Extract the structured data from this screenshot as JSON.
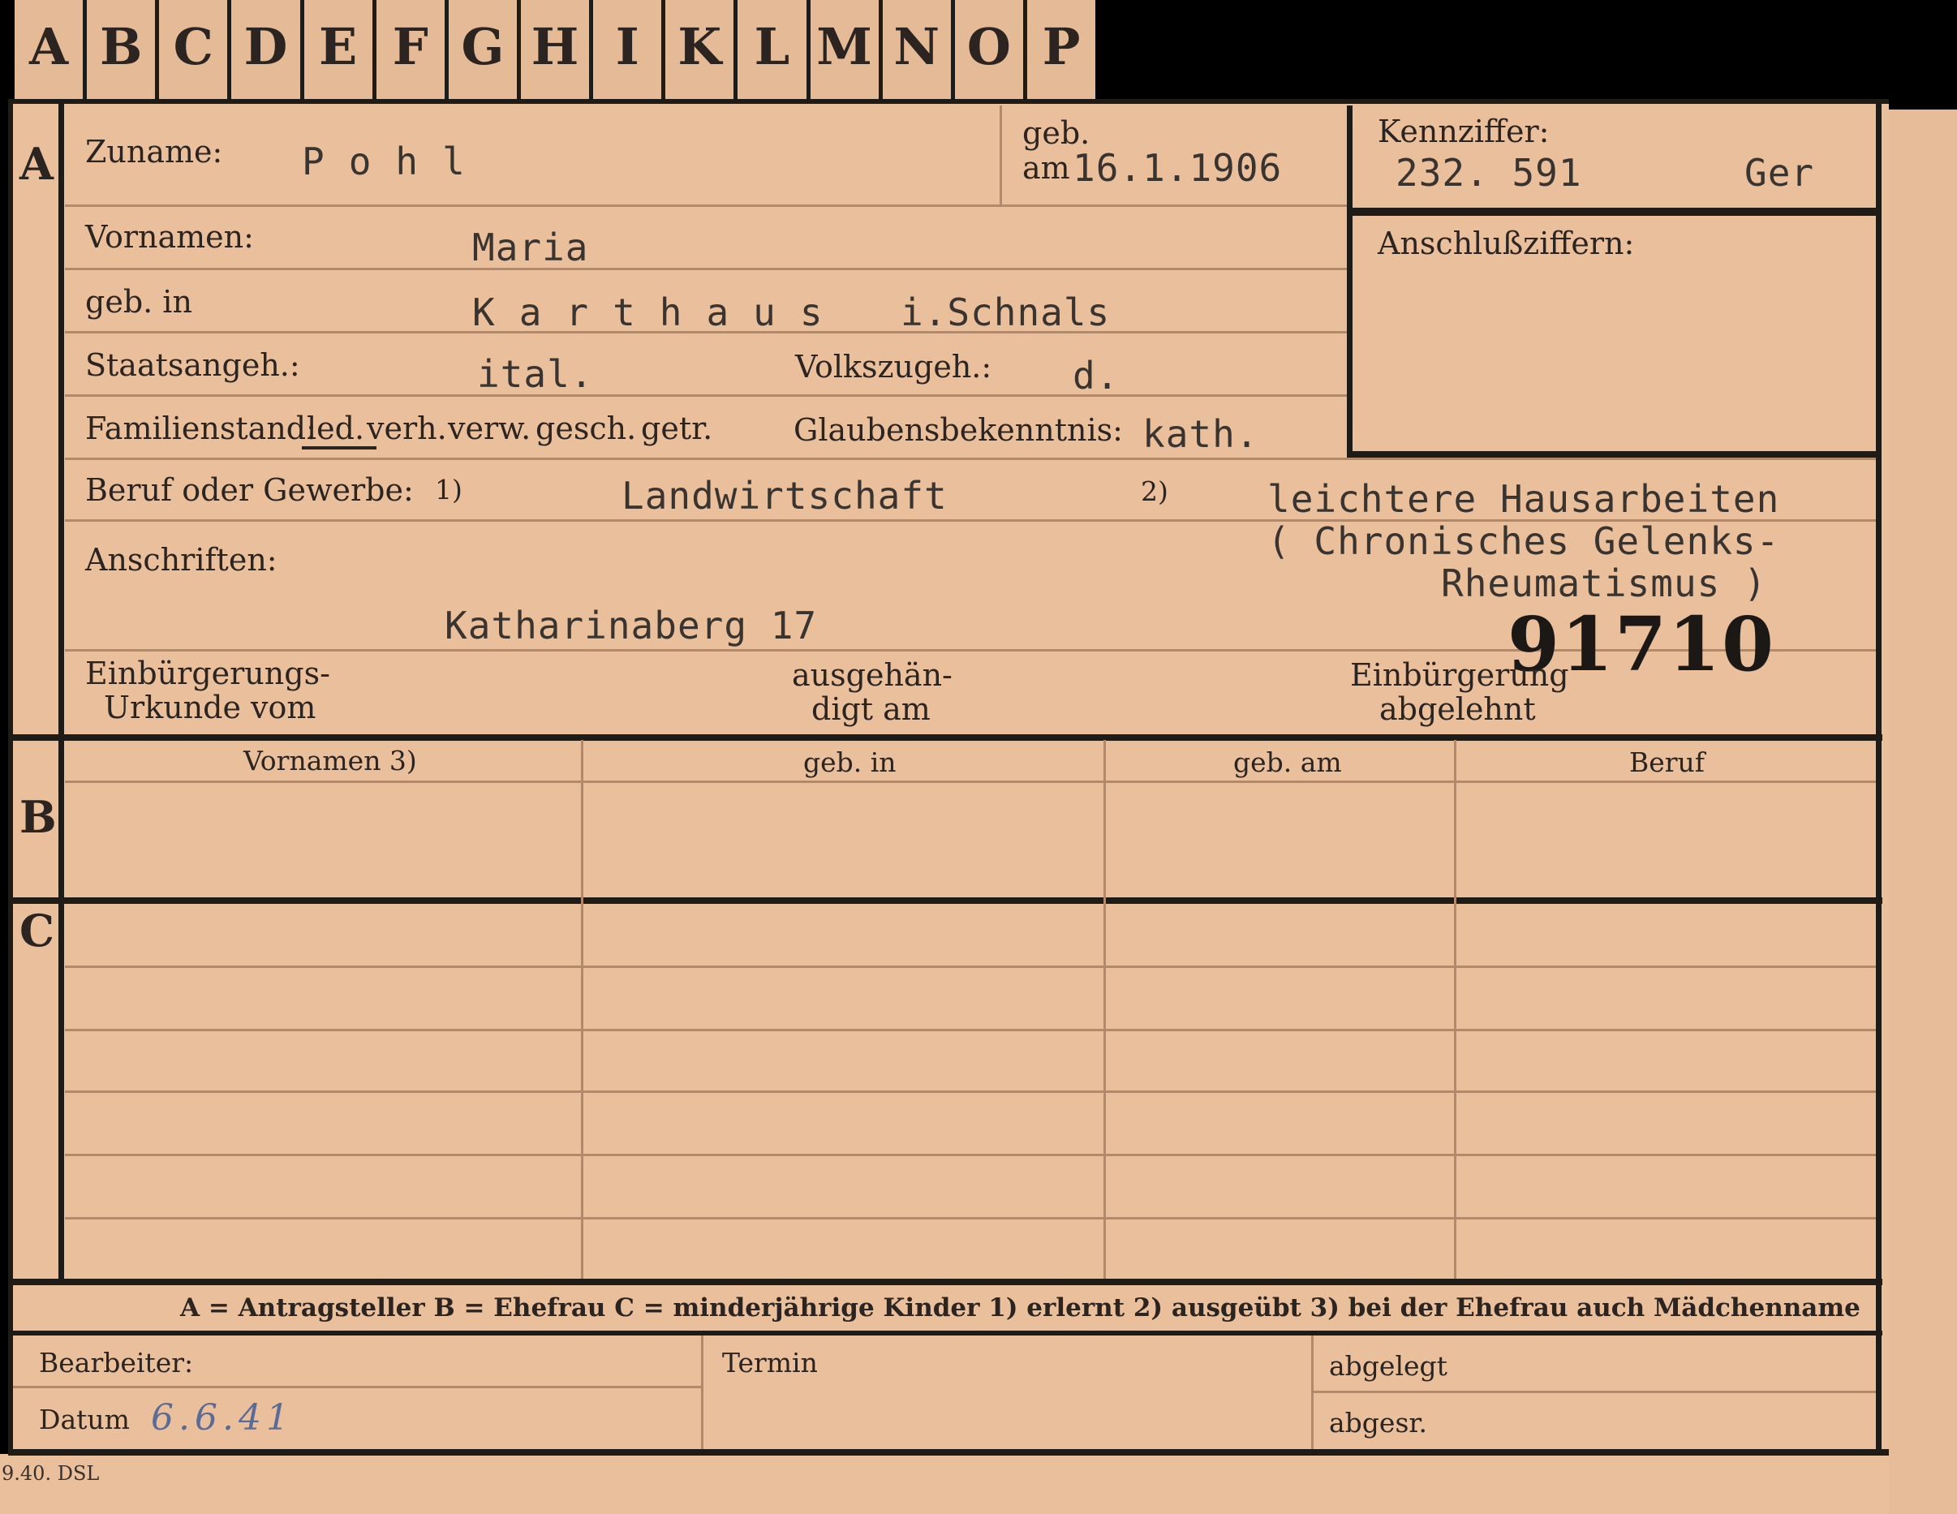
{
  "tabs": [
    "A",
    "B",
    "C",
    "D",
    "E",
    "F",
    "G",
    "H",
    "I",
    "K",
    "L",
    "M",
    "N",
    "O",
    "P"
  ],
  "sections": {
    "a": "A",
    "b": "B",
    "c": "C"
  },
  "header": {
    "surname_label": "Zuname:",
    "surname_value": "Pohl",
    "birth_label_top": "geb.",
    "birth_label_bottom": "am",
    "birth_date": "16.1.1906",
    "ref_label": "Kennziffer:",
    "ref_number": "232. 591",
    "ref_suffix": "Ger",
    "link_label": "Anschlußziffern:"
  },
  "fields": {
    "firstnames_label": "Vornamen:",
    "firstnames_value": "Maria",
    "birthplace_label": "geb. in",
    "birthplace_value": "Karthaus",
    "birthplace_extra": "i.Schnals",
    "citizenship_label": "Staatsangeh.:",
    "citizenship_value": "ital.",
    "ethnicity_label": "Volkszugeh.:",
    "ethnicity_value": "d.",
    "marital_label": "Familienstand:",
    "marital_options": [
      "led.",
      "verh.",
      "verw.",
      "gesch.",
      "getr."
    ],
    "religion_label": "Glaubensbekenntnis:",
    "religion_value": "kath.",
    "occupation_label": "Beruf oder Gewerbe:",
    "occupation_mark1": "1)",
    "occupation_learned": "Landwirtschaft",
    "occupation_mark2": "2)",
    "occupation_practiced_1": "leichtere Hausarbeiten",
    "occupation_practiced_2": "( Chronisches Gelenks-",
    "occupation_practiced_3": "Rheumatismus     )",
    "address_label": "Anschriften:",
    "address_value": "Katharinaberg 17",
    "file_number": "91710",
    "naturalization_doc_1": "Einbürgerungs-",
    "naturalization_doc_2": "Urkunde vom",
    "handed_1": "ausgehän-",
    "handed_2": "digt am",
    "refused_1": "Einbürgerung",
    "refused_2": "abgelehnt"
  },
  "table_b_headers": [
    "Vornamen 3)",
    "geb. in",
    "geb. am",
    "Beruf"
  ],
  "legend": "A = Antragsteller    B = Ehefrau    C = minderjährige Kinder    1) erlernt    2) ausgeübt    3) bei der Ehefrau auch Mädchenname",
  "footer": {
    "clerk_label": "Bearbeiter:",
    "date_label": "Datum",
    "date_value": "6.6.41",
    "deadline_label": "Termin",
    "filed_label": "abgelegt",
    "sent_label": "abgesr.",
    "print_code": "9.40. DSL"
  }
}
